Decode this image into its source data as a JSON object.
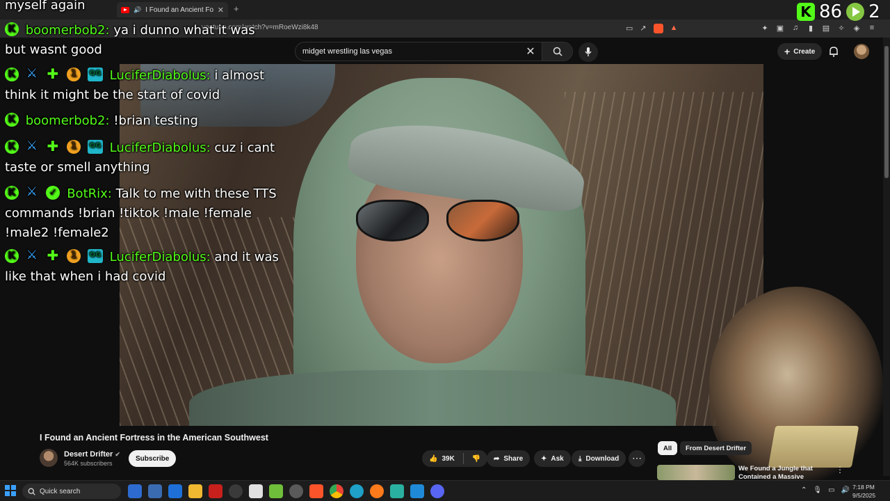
{
  "browser": {
    "tab_title": "I Found an Ancient Fortress in",
    "url": "youtube.com/watch?v=mRoeWzi8k48"
  },
  "youtube": {
    "search_value": "midget wrestling las vegas",
    "create_label": "Create"
  },
  "counters": {
    "kick_count": "86",
    "rumble_count": "2"
  },
  "chat": {
    "lines": [
      {
        "text": "myself again"
      },
      {
        "user": "boomerbob2:",
        "message": "ya i dunno what it was"
      },
      {
        "text": "but wasnt good"
      },
      {
        "user": "LuciferDiabolus:",
        "message": "i almost"
      },
      {
        "text": "think it might be the start of covid"
      },
      {
        "user": "boomerbob2:",
        "message": "!brian testing"
      },
      {
        "user": "LuciferDiabolus:",
        "message": "cuz i cant"
      },
      {
        "text": "taste or smell anything"
      },
      {
        "user": "BotRix:",
        "message": "Talk to me with these TTS"
      },
      {
        "text": "commands !brian !tiktok !male !female"
      },
      {
        "text": "!male2 !female2"
      },
      {
        "user": "LuciferDiabolus:",
        "message": "and it was"
      },
      {
        "text": "like that when i had covid"
      }
    ]
  },
  "video": {
    "title": "I Found an Ancient Fortress in the American Southwest",
    "channel": "Desert Drifter",
    "subscribers": "564K subscribers",
    "subscribe_label": "Subscribe",
    "likes": "39K",
    "share_label": "Share",
    "ask_label": "Ask",
    "download_label": "Download"
  },
  "sidebar": {
    "chips": [
      "All",
      "From Desert Drifter"
    ],
    "rec_title": "We Found a Jungle that Contained a Massive Ancient"
  },
  "taskbar": {
    "search_label": "Quick search",
    "time": "7:18 PM",
    "date": "9/5/2025"
  },
  "colors": {
    "kick_green": "#53fc18",
    "youtube_red": "#ff0000",
    "background": "#0f0f0f"
  }
}
